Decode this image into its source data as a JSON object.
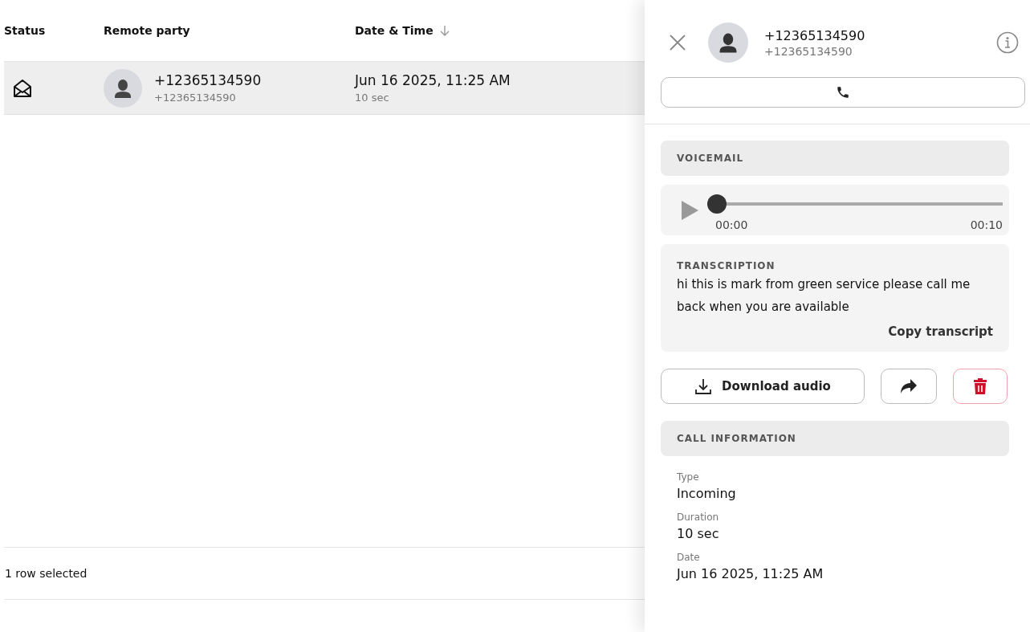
{
  "table": {
    "columns": [
      {
        "label": "Status",
        "sorted": false
      },
      {
        "label": "Remote party",
        "sorted": false
      },
      {
        "label": "Date & Time",
        "sorted": true
      }
    ],
    "rows": [
      {
        "selected": true,
        "name": "+12365134590",
        "number": "+12365134590",
        "datetime": "Jun 16 2025, 11:25 AM",
        "duration": "10 sec"
      }
    ]
  },
  "status_bar": {
    "text": "1 row selected"
  },
  "panel": {
    "name": "+12365134590",
    "number": "+12365134590",
    "voicemail": {
      "title": "VOICEMAIL",
      "level": 0,
      "elapsed": "00:00",
      "total": "00:10"
    },
    "transcription": {
      "title": "TRANSCRIPTION",
      "text": "hi this is mark from green service please call me back when you are available",
      "copy": "Copy transcript"
    },
    "download": "Download audio",
    "call_info": {
      "title": "CALL INFORMATION",
      "fields": [
        {
          "label": "Type",
          "value": "Incoming"
        },
        {
          "label": "Duration",
          "value": "10 sec"
        },
        {
          "label": "Date",
          "value": "Jun 16 2025, 11:25 AM"
        }
      ]
    }
  }
}
